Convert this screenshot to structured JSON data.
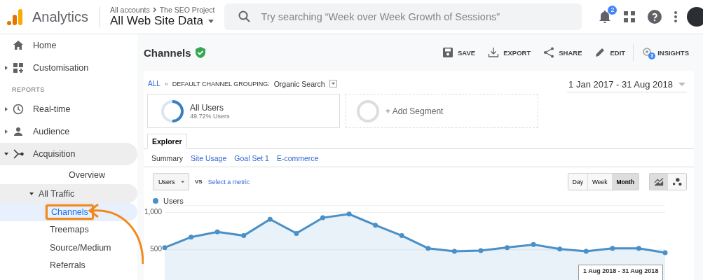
{
  "header": {
    "product": "Analytics",
    "breadcrumb": [
      "All accounts",
      "The SEO Project"
    ],
    "property": "All Web Site Data",
    "search": {
      "placeholder": "Try searching “Week over Week Growth of Sessions”"
    },
    "notification_count": "2"
  },
  "sidebar": {
    "items": [
      {
        "kind": "item",
        "label": "Home",
        "selected": false
      },
      {
        "kind": "item",
        "label": "Customisation",
        "expanded": false,
        "selected": false
      },
      {
        "kind": "heading",
        "label": "REPORTS"
      },
      {
        "kind": "item",
        "label": "Real-time",
        "expanded": false,
        "selected": false
      },
      {
        "kind": "item",
        "label": "Audience",
        "expanded": false,
        "selected": false
      },
      {
        "kind": "item",
        "label": "Acquisition",
        "expanded": true,
        "selected": false,
        "children": [
          {
            "kind": "item",
            "label": "Overview",
            "selected": false
          },
          {
            "kind": "item",
            "label": "All Traffic",
            "expanded": true,
            "selected": false,
            "children": [
              {
                "kind": "item",
                "label": "Channels",
                "selected": true,
                "highlighted": true
              },
              {
                "kind": "item",
                "label": "Treemaps",
                "selected": false,
                "highlighted": false
              },
              {
                "kind": "item",
                "label": "Source/Medium",
                "selected": false,
                "highlighted": false
              },
              {
                "kind": "item",
                "label": "Referrals",
                "selected": false,
                "highlighted": false
              }
            ]
          }
        ]
      }
    ]
  },
  "report": {
    "title": "Channels",
    "verified": true,
    "actions": [
      {
        "label": "SAVE"
      },
      {
        "label": "EXPORT"
      },
      {
        "label": "SHARE"
      },
      {
        "label": "EDIT"
      },
      {
        "label": "INSIGHTS",
        "badge": "3"
      }
    ],
    "breadcrumb": {
      "root": "ALL",
      "separator": "»",
      "dimension": "DEFAULT CHANNEL GROUPING:",
      "value": "Organic Search"
    },
    "date_range": "1 Jan 2017 - 31 Aug 2018",
    "segments": [
      {
        "kind": "segment",
        "name": "All Users",
        "share": "49.72% Users",
        "level": 0.4972
      },
      {
        "kind": "add",
        "name": "+ Add Segment"
      }
    ],
    "tabs": [
      {
        "label": "Explorer",
        "selected": true
      }
    ],
    "subtabs": [
      {
        "label": "Summary",
        "selected": true
      },
      {
        "label": "Site Usage",
        "selected": false
      },
      {
        "label": "Goal Set 1",
        "selected": false
      },
      {
        "label": "E-commerce",
        "selected": false
      }
    ],
    "metric": "Users",
    "vs": "VS",
    "second_metric": "Select a metric",
    "granularity": [
      {
        "label": "Day",
        "selected": false
      },
      {
        "label": "Week",
        "selected": false
      },
      {
        "label": "Month",
        "selected": true
      }
    ],
    "chart_types": [
      {
        "kind": "line",
        "selected": true
      },
      {
        "kind": "motion",
        "selected": false
      }
    ],
    "chart_data": {
      "type": "area",
      "ylim": [
        0,
        1100
      ],
      "yticks": [
        {
          "value": 500,
          "label": "500"
        },
        {
          "value": 1000,
          "label": "1,000"
        }
      ],
      "series": [
        {
          "name": "Users",
          "color": "#4a90c8",
          "values": [
            530,
            670,
            740,
            690,
            910,
            720,
            930,
            980,
            830,
            690,
            520,
            480,
            490,
            530,
            570,
            510,
            480,
            520,
            520,
            460
          ]
        }
      ]
    },
    "tooltip": "1 Aug 2018 - 31 Aug 2018"
  }
}
